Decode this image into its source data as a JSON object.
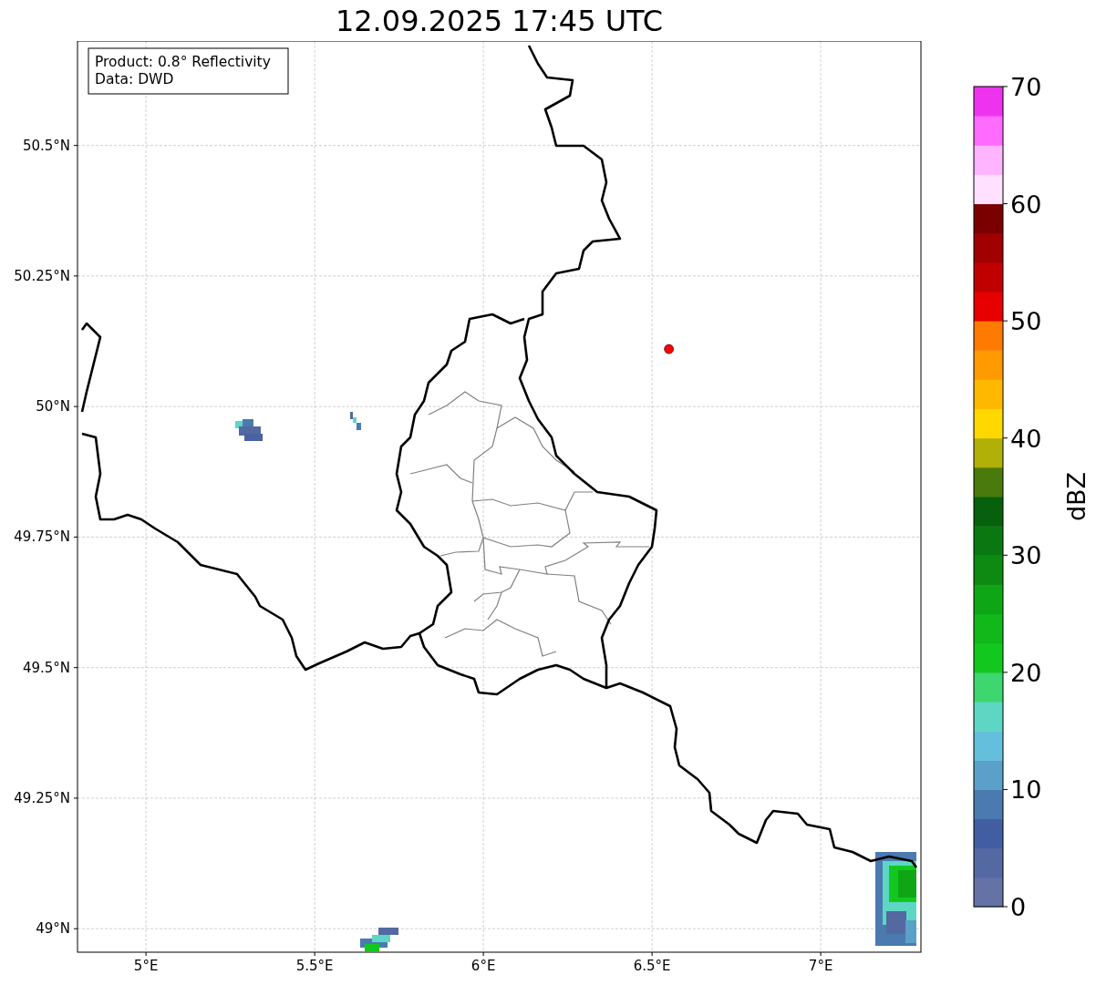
{
  "title": "12.09.2025 17:45 UTC",
  "info_box": {
    "lines": [
      "Product: 0.8° Reflectivity",
      "Data: DWD"
    ]
  },
  "map": {
    "chart_data": {
      "type": "scatter",
      "grid": true,
      "xlim": [
        4.797,
        7.297
      ],
      "ylim": [
        48.955,
        50.7
      ],
      "xticks": [
        {
          "value": 5,
          "label": "5°E"
        },
        {
          "value": 5.5,
          "label": "5.5°E"
        },
        {
          "value": 6,
          "label": "6°E"
        },
        {
          "value": 6.5,
          "label": "6.5°E"
        },
        {
          "value": 7,
          "label": "7°E"
        }
      ],
      "yticks": [
        {
          "value": 49,
          "label": "49°N"
        },
        {
          "value": 49.25,
          "label": "49.25°N"
        },
        {
          "value": 49.5,
          "label": "49.5°N"
        },
        {
          "value": 49.75,
          "label": "49.75°N"
        },
        {
          "value": 50,
          "label": "50°N"
        },
        {
          "value": 50.25,
          "label": "50.25°N"
        },
        {
          "value": 50.5,
          "label": "50.5°N"
        }
      ],
      "x": [
        6.55
      ],
      "series": [
        {
          "color": "#ff0000",
          "values": [
            50.11
          ]
        }
      ]
    }
  },
  "colorbar": {
    "label": "dBZ",
    "ticks": [
      "70",
      "60",
      "50",
      "40",
      "30",
      "20",
      "10",
      "0"
    ],
    "bins": [
      {
        "color": "#6472a6"
      },
      {
        "color": "#5468a2"
      },
      {
        "color": "#425ea2"
      },
      {
        "color": "#4a7ab0"
      },
      {
        "color": "#5aa0c8"
      },
      {
        "color": "#64bfdc"
      },
      {
        "color": "#5ed6c4"
      },
      {
        "color": "#3ed66e"
      },
      {
        "color": "#12c81e"
      },
      {
        "color": "#10b81a"
      },
      {
        "color": "#0ea614"
      },
      {
        "color": "#0c8a12"
      },
      {
        "color": "#0a7810"
      },
      {
        "color": "#07600c"
      },
      {
        "color": "#4a7a0c"
      },
      {
        "color": "#b0b008"
      },
      {
        "color": "#ffd800"
      },
      {
        "color": "#ffb800"
      },
      {
        "color": "#ff9a00"
      },
      {
        "color": "#ff7a00"
      },
      {
        "color": "#e60000"
      },
      {
        "color": "#c00000"
      },
      {
        "color": "#a00000"
      },
      {
        "color": "#7a0000"
      },
      {
        "color": "#ffe0ff"
      },
      {
        "color": "#ffb4ff"
      },
      {
        "color": "#ff6aff"
      },
      {
        "color": "#ee33ee"
      }
    ]
  }
}
